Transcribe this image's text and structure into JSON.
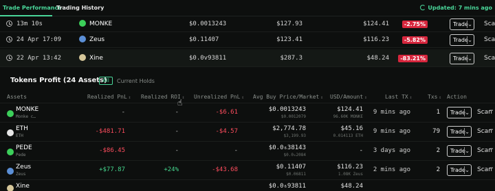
{
  "tabs": {
    "performance": "Trade Performance",
    "history": "Trading History"
  },
  "status": {
    "updated": "Updated: 7 mins ago"
  },
  "colors": {
    "accent": "#4ad79a",
    "negative": "#ff4d5e",
    "positive": "#46d88f",
    "loss_badge": "#d7263d"
  },
  "trades": [
    {
      "time": "13m 10s",
      "token": "MONKE",
      "price": "$0.0013243",
      "amount": "$127.93",
      "value": "$124.41",
      "change": "-2.75%",
      "icon_color": "#3ccf5a"
    },
    {
      "time": "24 Apr 17:09",
      "token": "Zeus",
      "price": "$0.11407",
      "amount": "$123.41",
      "value": "$116.23",
      "change": "-5.82%",
      "icon_color": "#5b8fd6"
    },
    {
      "time": "22 Apr 13:42",
      "token": "Xine",
      "price": "$0.0v93811",
      "amount": "$287.3",
      "value": "$48.24",
      "change": "-83.21%",
      "icon_color": "#d6c79a"
    }
  ],
  "trade_label": "Trade",
  "scan_label": "Scan",
  "tokens_profit": {
    "title": "Tokens Profit (24 Assets)",
    "filter_all": "All",
    "filter_current": "Current Holds",
    "headers": {
      "assets": "Assets",
      "realized_pnl": "Realized PnL",
      "realized_roi": "Realized ROI",
      "unrealized_pnl": "Unrealized PnL",
      "avg_price": "Avg Buy Price/Market",
      "usd_amount": "USD/Amount",
      "last_tx": "Last TX",
      "txs": "Txs",
      "action": "Action"
    },
    "rows": [
      {
        "name": "MONKE",
        "sub": "Monke c…",
        "realized_pnl": "-",
        "realized_roi": "-",
        "unrealized_pnl": "-$6.61",
        "avg": "$0.0013243",
        "avg_sub": "$0.0012079",
        "usd": "$124.41",
        "usd_sub": "96.60K MONKE",
        "last_tx": "9 mins ago",
        "txs": "1",
        "icon_color": "#3ccf5a"
      },
      {
        "name": "ETH",
        "sub": "ETH",
        "realized_pnl": "-$481.71",
        "realized_roi": "-",
        "unrealized_pnl": "-$4.57",
        "avg": "$2,774.78",
        "avg_sub": "$3,199.93",
        "usd": "$45.16",
        "usd_sub": "0.014113 ETH",
        "last_tx": "9 mins ago",
        "txs": "79",
        "icon_color": "#e6e6e6"
      },
      {
        "name": "PEDE",
        "sub": "Pede",
        "realized_pnl": "-$86.45",
        "realized_roi": "-",
        "unrealized_pnl": "-",
        "avg": "$0.0₆38143",
        "avg_sub": "$0.0₆2084",
        "usd": "-",
        "usd_sub": "",
        "last_tx": "3 days ago",
        "txs": "2",
        "icon_color": "#3ccf5a"
      },
      {
        "name": "Zeus",
        "sub": "Zeus",
        "realized_pnl": "+$77.87",
        "realized_roi": "+24%",
        "unrealized_pnl": "-$43.68",
        "avg": "$0.11407",
        "avg_sub": "$0.06811",
        "usd": "$116.23",
        "usd_sub": "1.08K Zeus",
        "last_tx": "2 mins ago",
        "txs": "2",
        "icon_color": "#5b8fd6"
      },
      {
        "name": "Xine",
        "sub": "",
        "realized_pnl": "",
        "realized_roi": "",
        "unrealized_pnl": "",
        "avg": "$0.0₆93811",
        "avg_sub": "",
        "usd": "$48.24",
        "usd_sub": "",
        "last_tx": "",
        "txs": "",
        "icon_color": "#d6c79a"
      }
    ]
  }
}
